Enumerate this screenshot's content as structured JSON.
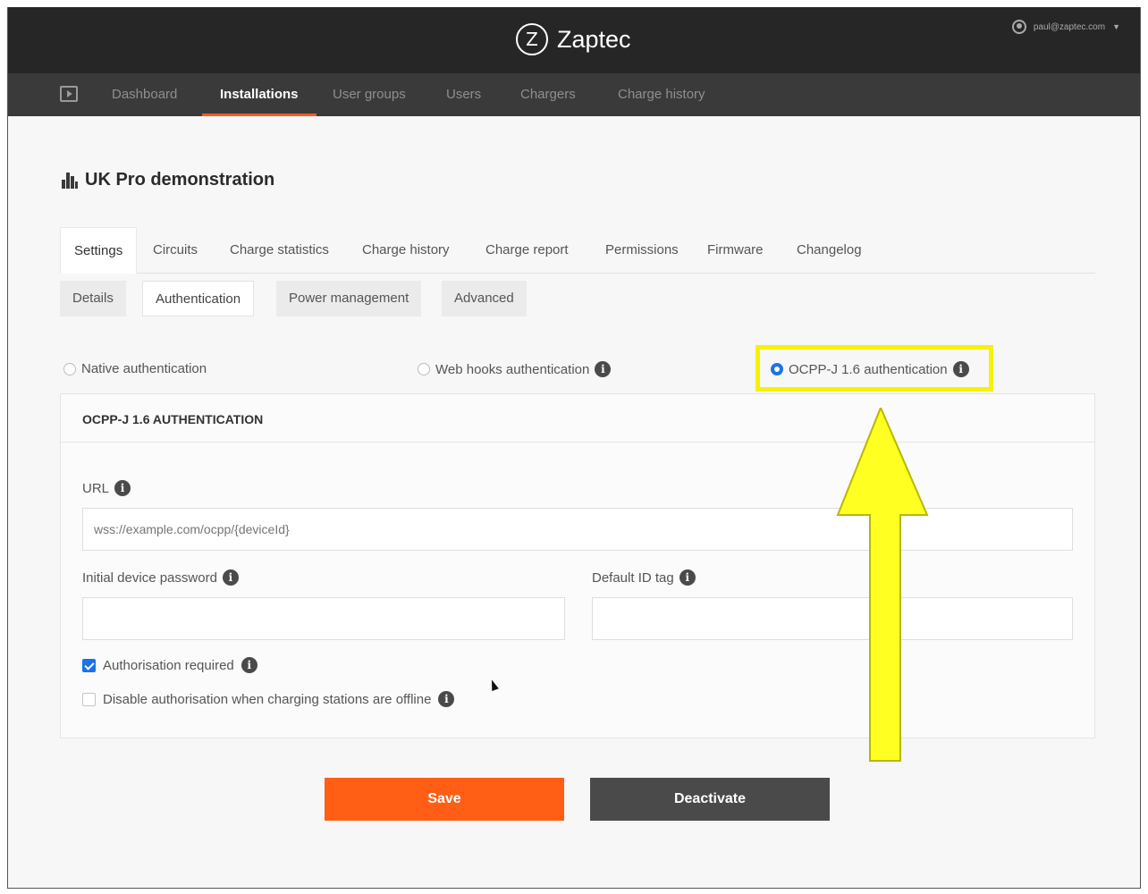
{
  "app": {
    "brand_mark": "Z",
    "brand_name": "Zaptec",
    "account_email": "paul@zaptec.com",
    "account_caret": "▼"
  },
  "nav": {
    "items": [
      {
        "label": "Dashboard"
      },
      {
        "label": "Installations",
        "active": true
      },
      {
        "label": "User groups"
      },
      {
        "label": "Users"
      },
      {
        "label": "Chargers"
      },
      {
        "label": "Charge history"
      }
    ]
  },
  "page": {
    "title": "UK Pro demonstration"
  },
  "tabs": [
    {
      "label": "Settings",
      "active": true
    },
    {
      "label": "Circuits"
    },
    {
      "label": "Charge statistics"
    },
    {
      "label": "Charge history"
    },
    {
      "label": "Charge report"
    },
    {
      "label": "Permissions"
    },
    {
      "label": "Firmware"
    },
    {
      "label": "Changelog"
    }
  ],
  "subtabs": [
    {
      "label": "Details"
    },
    {
      "label": "Authentication",
      "active": true
    },
    {
      "label": "Power management"
    },
    {
      "label": "Advanced"
    }
  ],
  "auth_options": [
    {
      "label": "Native authentication",
      "selected": false
    },
    {
      "label": "Web hooks authentication",
      "selected": false
    },
    {
      "label": "OCPP-J 1.6 authentication",
      "selected": true
    }
  ],
  "card": {
    "header": "OCPP-J 1.6 AUTHENTICATION",
    "url_label": "URL",
    "url_placeholder": "wss://example.com/ocpp/{deviceId}",
    "password_label": "Initial device password",
    "password_value": "",
    "id_tag_label": "Default ID tag",
    "id_tag_value": "",
    "auth_required_label": "Authorisation required",
    "auth_required_checked": true,
    "disable_offline_label": "Disable authorisation when charging stations are offline",
    "disable_offline_checked": false
  },
  "info_glyph": "i",
  "buttons": {
    "save": "Save",
    "deactivate": "Deactivate"
  },
  "colors": {
    "accent": "#ff5e14",
    "highlight": "#f6f200",
    "topbar": "#262626",
    "navbar": "#3a3a3a",
    "selected_blue": "#1a73e8"
  }
}
